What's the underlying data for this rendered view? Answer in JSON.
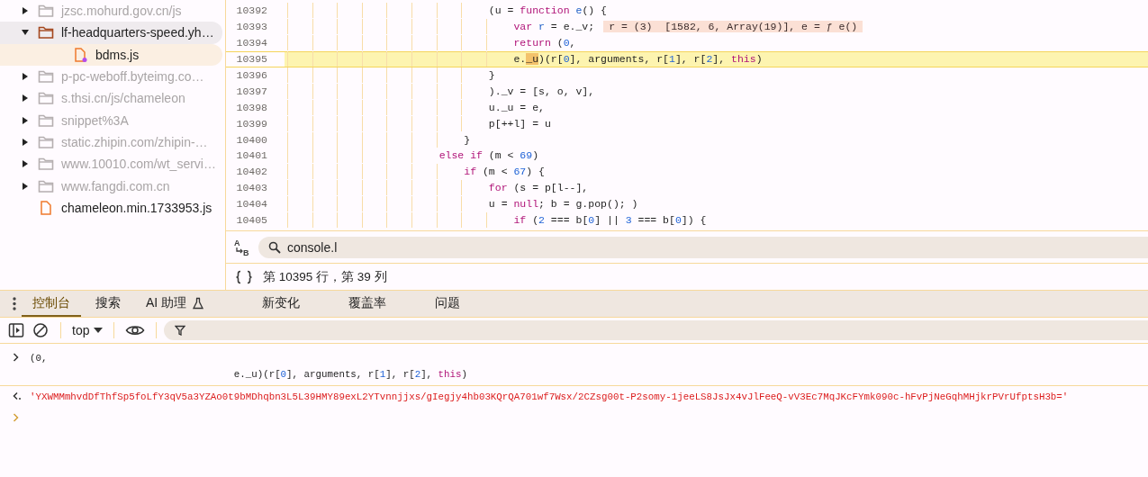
{
  "sidebar": {
    "tree": [
      {
        "kind": "folder",
        "label": "jzsc.mohurd.gov.cn/js",
        "dimmed": true,
        "expanded": false,
        "hovered": false,
        "selected": false
      },
      {
        "kind": "folder",
        "label": "lf-headquarters-speed.yh…",
        "dimmed": false,
        "expanded": true,
        "hovered": true,
        "selected": false,
        "children": [
          {
            "kind": "file",
            "label": "bdms.js",
            "marked": true,
            "hovered": false,
            "selected": true
          }
        ]
      },
      {
        "kind": "folder",
        "label": "p-pc-weboff.byteimg.co…",
        "dimmed": true,
        "expanded": false,
        "hovered": false,
        "selected": false
      },
      {
        "kind": "folder",
        "label": "s.thsi.cn/js/chameleon",
        "dimmed": true,
        "expanded": false,
        "hovered": false,
        "selected": false
      },
      {
        "kind": "folder",
        "label": "snippet%3A",
        "dimmed": true,
        "expanded": false,
        "hovered": false,
        "selected": false
      },
      {
        "kind": "folder",
        "label": "static.zhipin.com/zhipin-…",
        "dimmed": true,
        "expanded": false,
        "hovered": false,
        "selected": false
      },
      {
        "kind": "folder",
        "label": "www.10010.com/wt_servi…",
        "dimmed": true,
        "expanded": false,
        "hovered": false,
        "selected": false
      },
      {
        "kind": "folder",
        "label": "www.fangdi.com.cn",
        "dimmed": true,
        "expanded": false,
        "hovered": false,
        "selected": false
      },
      {
        "kind": "file",
        "label": "chameleon.min.1733953.js",
        "marked": false,
        "hovered": false,
        "selected": false
      }
    ]
  },
  "code": {
    "lines": [
      {
        "number": "10392",
        "selected": false,
        "segments": [
          {
            "kind": "plain",
            "text": "                                (u = "
          },
          {
            "kind": "keyword",
            "text": "function "
          },
          {
            "kind": "def",
            "text": "e"
          },
          {
            "kind": "plain",
            "text": "() {"
          }
        ]
      },
      {
        "number": "10393",
        "selected": false,
        "annotation": "r = (3)  [1582, 6, Array(19)], e = ƒ e()",
        "segments": [
          {
            "kind": "keyword",
            "text": "                                    var "
          },
          {
            "kind": "def",
            "text": "r"
          },
          {
            "kind": "plain",
            "text": " = e._v;"
          }
        ]
      },
      {
        "number": "10394",
        "selected": false,
        "segments": [
          {
            "kind": "keyword",
            "text": "                                    return"
          },
          {
            "kind": "plain",
            "text": " ("
          },
          {
            "kind": "number",
            "text": "0"
          },
          {
            "kind": "plain",
            "text": ","
          }
        ]
      },
      {
        "number": "10395",
        "selected": true,
        "segments": [
          {
            "kind": "plain",
            "text": "                                    e."
          },
          {
            "kind": "hit",
            "text": "_u"
          },
          {
            "kind": "plain",
            "text": ")(r["
          },
          {
            "kind": "number",
            "text": "0"
          },
          {
            "kind": "plain",
            "text": "], arguments, r["
          },
          {
            "kind": "number",
            "text": "1"
          },
          {
            "kind": "plain",
            "text": "], r["
          },
          {
            "kind": "number",
            "text": "2"
          },
          {
            "kind": "plain",
            "text": "], "
          },
          {
            "kind": "keyword",
            "text": "this"
          },
          {
            "kind": "plain",
            "text": ")"
          }
        ]
      },
      {
        "number": "10396",
        "selected": false,
        "segments": [
          {
            "kind": "plain",
            "text": "                                }"
          }
        ]
      },
      {
        "number": "10397",
        "selected": false,
        "segments": [
          {
            "kind": "plain",
            "text": "                                )._v = [s, o, v],"
          }
        ]
      },
      {
        "number": "10398",
        "selected": false,
        "segments": [
          {
            "kind": "plain",
            "text": "                                u._u = e,"
          }
        ]
      },
      {
        "number": "10399",
        "selected": false,
        "segments": [
          {
            "kind": "plain",
            "text": "                                p[++l] = u"
          }
        ]
      },
      {
        "number": "10400",
        "selected": false,
        "segments": [
          {
            "kind": "plain",
            "text": "                            }"
          }
        ]
      },
      {
        "number": "10401",
        "selected": false,
        "segments": [
          {
            "kind": "keyword",
            "text": "                        else if"
          },
          {
            "kind": "plain",
            "text": " (m < "
          },
          {
            "kind": "number",
            "text": "69"
          },
          {
            "kind": "plain",
            "text": ")"
          }
        ]
      },
      {
        "number": "10402",
        "selected": false,
        "segments": [
          {
            "kind": "keyword",
            "text": "                            if"
          },
          {
            "kind": "plain",
            "text": " (m < "
          },
          {
            "kind": "number",
            "text": "67"
          },
          {
            "kind": "plain",
            "text": ") {"
          }
        ]
      },
      {
        "number": "10403",
        "selected": false,
        "segments": [
          {
            "kind": "keyword",
            "text": "                                for"
          },
          {
            "kind": "plain",
            "text": " (s = p[l--],"
          }
        ]
      },
      {
        "number": "10404",
        "selected": false,
        "segments": [
          {
            "kind": "plain",
            "text": "                                u = "
          },
          {
            "kind": "keyword",
            "text": "null"
          },
          {
            "kind": "plain",
            "text": "; b = g.pop(); )"
          }
        ]
      },
      {
        "number": "10405",
        "selected": false,
        "segments": [
          {
            "kind": "keyword",
            "text": "                                    if"
          },
          {
            "kind": "plain",
            "text": " ("
          },
          {
            "kind": "number",
            "text": "2"
          },
          {
            "kind": "plain",
            "text": " === b["
          },
          {
            "kind": "number",
            "text": "0"
          },
          {
            "kind": "plain",
            "text": "] || "
          },
          {
            "kind": "number",
            "text": "3"
          },
          {
            "kind": "plain",
            "text": " === b["
          },
          {
            "kind": "number",
            "text": "0"
          },
          {
            "kind": "plain",
            "text": "]) {"
          }
        ]
      }
    ]
  },
  "search": {
    "toggle_letters": [
      "A",
      "B"
    ],
    "value": "console.l"
  },
  "status_bar": {
    "position": "第 10395 行，第 39 列"
  },
  "drawer_tabs": [
    {
      "label": "控制台",
      "selected": true,
      "experimental": false
    },
    {
      "label": "搜索",
      "selected": false,
      "experimental": false
    },
    {
      "label": "AI 助理",
      "selected": false,
      "experimental": true
    },
    {
      "label": "新变化",
      "selected": false,
      "experimental": false
    },
    {
      "label": "覆盖率",
      "selected": false,
      "experimental": false
    },
    {
      "label": "问题",
      "selected": false,
      "experimental": false
    }
  ],
  "console_toolbar": {
    "context": "top"
  },
  "console": {
    "entries": [
      {
        "kind": "input",
        "segments": [
          {
            "kind": "plain",
            "text": "(0,\n                                   e._u)(r["
          },
          {
            "kind": "number",
            "text": "0"
          },
          {
            "kind": "plain",
            "text": "], arguments, r["
          },
          {
            "kind": "number",
            "text": "1"
          },
          {
            "kind": "plain",
            "text": "], r["
          },
          {
            "kind": "number",
            "text": "2"
          },
          {
            "kind": "plain",
            "text": "], "
          },
          {
            "kind": "keyword",
            "text": "this"
          },
          {
            "kind": "plain",
            "text": ")"
          }
        ]
      },
      {
        "kind": "result",
        "segments": [
          {
            "kind": "string",
            "text": "'YXWMMmhvdDfThfSp5foLfY3qV5a3YZAo0t9bMDhqbn3L5L39HMY89exL2YTvnnjjxs/gIegjy4hb03KQrQA701wf7Wsx/2CZsg00t-P2somy-1jeeLS8JsJx4vJlFeeQ-vV3Ec7MqJKcFYmk090c-hFvPjNeGqhMHjkrPVrUfptsH3b='"
          }
        ]
      }
    ]
  }
}
